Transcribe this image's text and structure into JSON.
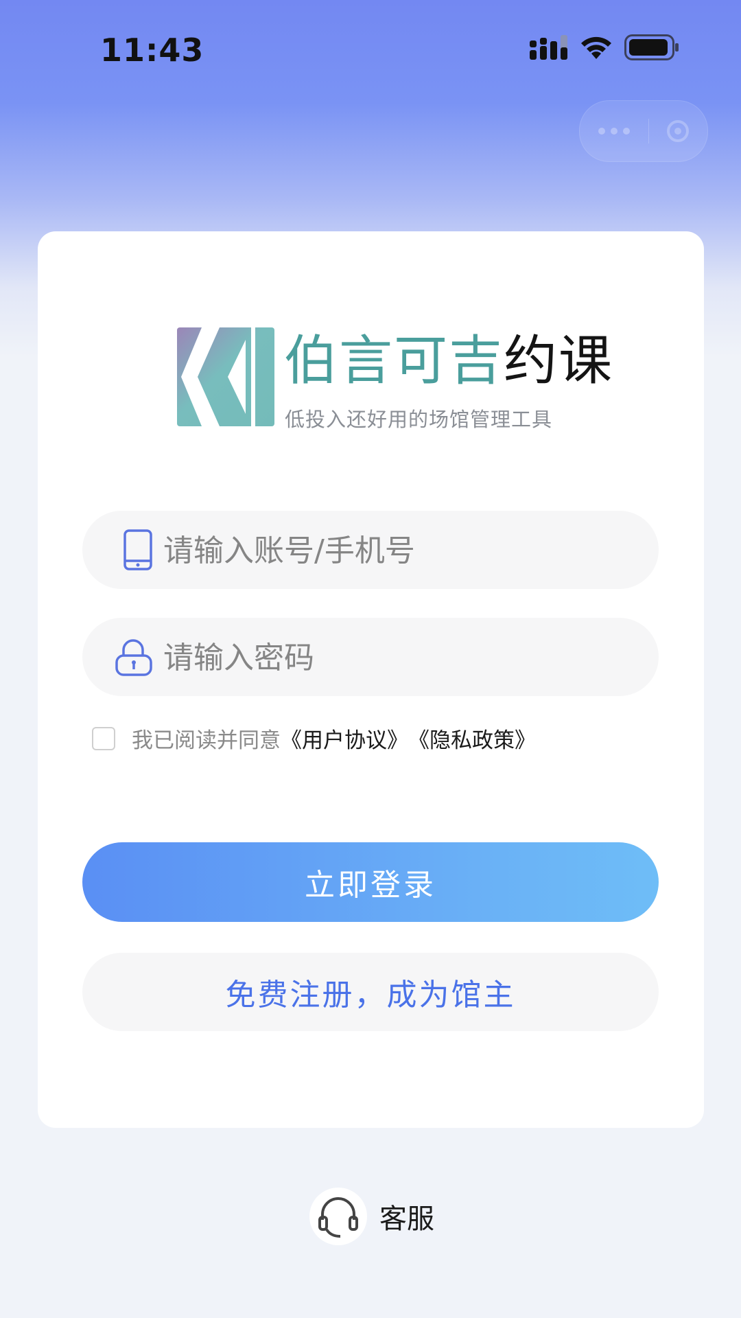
{
  "status_bar": {
    "time": "11:43",
    "icons": [
      "signal-icon",
      "wifi-icon",
      "battery-icon"
    ]
  },
  "brand": {
    "name_part1": "伯言可吉",
    "name_part2": "约课",
    "slogan": "低投入还好用的场馆管理工具",
    "colors": {
      "teal": "#4a9e9c",
      "dark": "#141414"
    }
  },
  "form": {
    "account_placeholder": "请输入账号/手机号",
    "password_placeholder": "请输入密码",
    "agree_prefix": "我已阅读并同意",
    "user_agreement": "《用户协议》",
    "privacy_policy": "《隐私政策》",
    "login_label": "立即登录",
    "register_label": "免费注册，成为馆主"
  },
  "footer": {
    "service_label": "客服"
  },
  "colors": {
    "primary_gradient_start": "#5a8ff4",
    "primary_gradient_end": "#6ebdf7",
    "register_text": "#4a72e8",
    "icon_blue": "#5a74e0"
  }
}
